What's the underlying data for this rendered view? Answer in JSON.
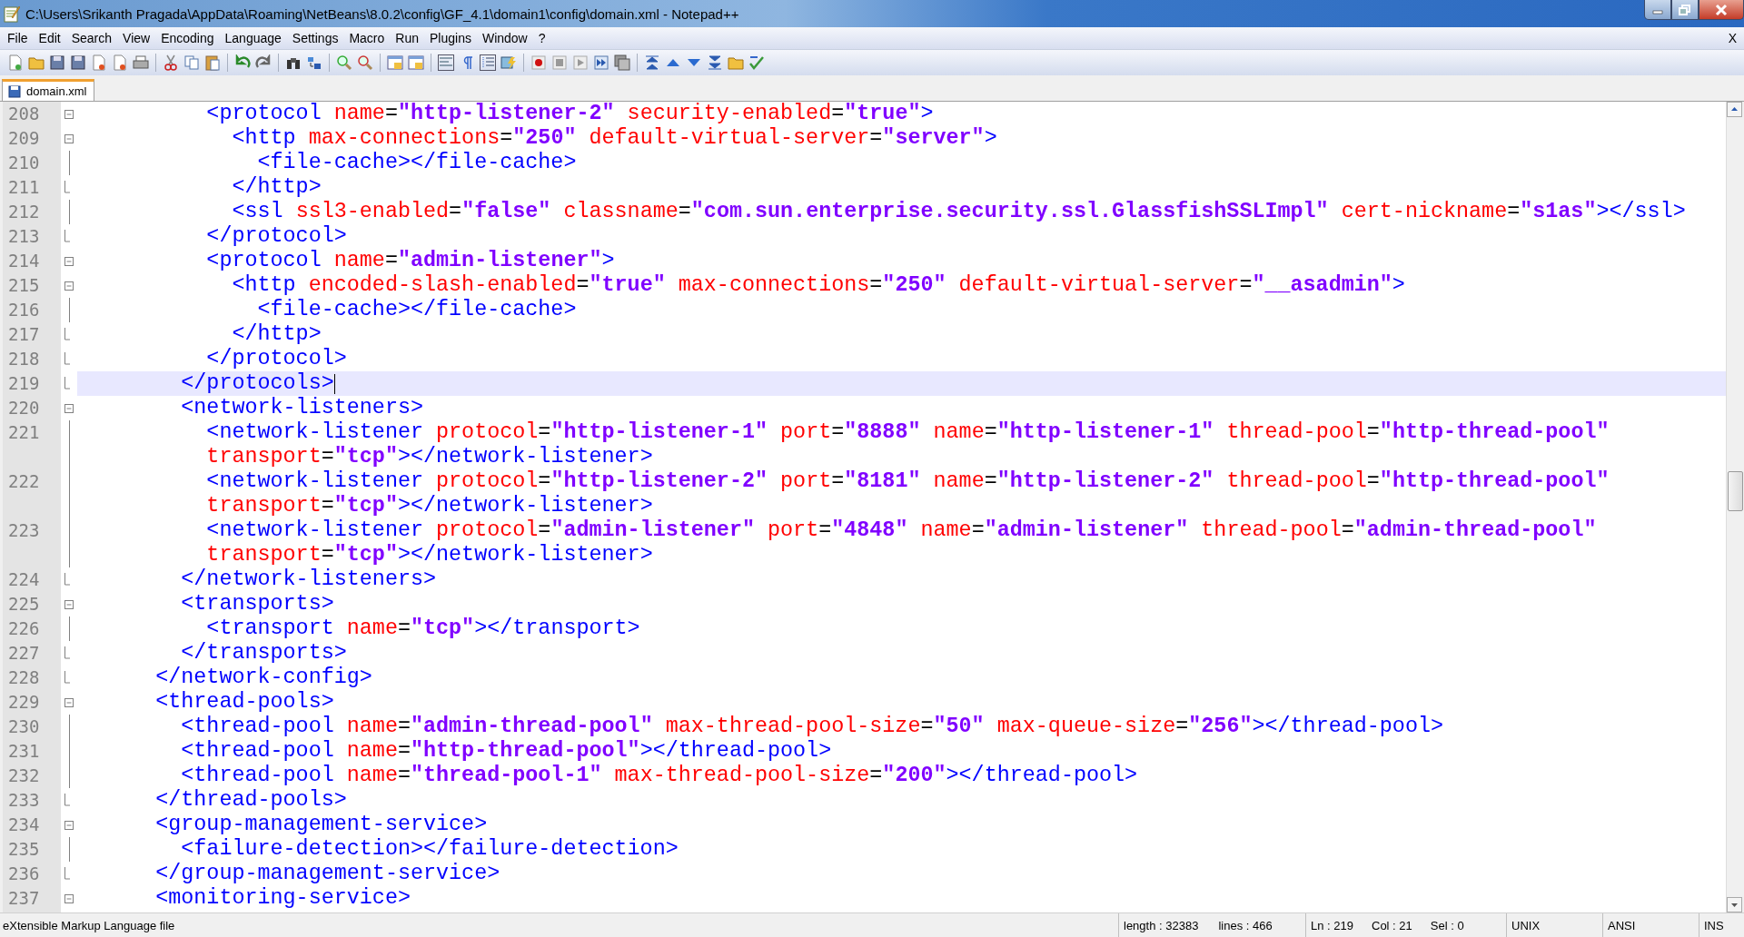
{
  "window": {
    "title": "C:\\Users\\Srikanth Pragada\\AppData\\Roaming\\NetBeans\\8.0.2\\config\\GF_4.1\\domain1\\config\\domain.xml - Notepad++"
  },
  "menu": [
    "File",
    "Edit",
    "Search",
    "View",
    "Encoding",
    "Language",
    "Settings",
    "Macro",
    "Run",
    "Plugins",
    "Window",
    "?"
  ],
  "close_document": "X",
  "tabs": [
    {
      "label": "domain.xml",
      "selected": true
    }
  ],
  "editor": {
    "lines": [
      {
        "number": "208",
        "kind": "open",
        "current": false,
        "segments": [
          {
            "kind": "tag",
            "text": "          <protocol"
          },
          {
            "kind": "attr",
            "text": " name"
          },
          {
            "kind": "op",
            "text": "="
          },
          {
            "kind": "value",
            "text": "\"http-listener-2\""
          },
          {
            "kind": "attr",
            "text": " security-enabled"
          },
          {
            "kind": "op",
            "text": "="
          },
          {
            "kind": "value",
            "text": "\"true\""
          },
          {
            "kind": "tag",
            "text": ">"
          }
        ]
      },
      {
        "number": "209",
        "kind": "open",
        "current": false,
        "segments": [
          {
            "kind": "tag",
            "text": "            <http"
          },
          {
            "kind": "attr",
            "text": " max-connections"
          },
          {
            "kind": "op",
            "text": "="
          },
          {
            "kind": "value",
            "text": "\"250\""
          },
          {
            "kind": "attr",
            "text": " default-virtual-server"
          },
          {
            "kind": "op",
            "text": "="
          },
          {
            "kind": "value",
            "text": "\"server\""
          },
          {
            "kind": "tag",
            "text": ">"
          }
        ]
      },
      {
        "number": "210",
        "kind": "mid",
        "current": false,
        "segments": [
          {
            "kind": "tag",
            "text": "              <file-cache></file-cache>"
          }
        ]
      },
      {
        "number": "211",
        "kind": "end",
        "current": false,
        "segments": [
          {
            "kind": "tag",
            "text": "            </http>"
          }
        ]
      },
      {
        "number": "212",
        "kind": "mid",
        "current": false,
        "segments": [
          {
            "kind": "tag",
            "text": "            <ssl"
          },
          {
            "kind": "attr",
            "text": " ssl3-enabled"
          },
          {
            "kind": "op",
            "text": "="
          },
          {
            "kind": "value",
            "text": "\"false\""
          },
          {
            "kind": "attr",
            "text": " classname"
          },
          {
            "kind": "op",
            "text": "="
          },
          {
            "kind": "value",
            "text": "\"com.sun.enterprise.security.ssl.GlassfishSSLImpl\""
          },
          {
            "kind": "attr",
            "text": " cert-nickname"
          },
          {
            "kind": "op",
            "text": "="
          },
          {
            "kind": "value",
            "text": "\"s1as\""
          },
          {
            "kind": "tag",
            "text": "></ssl>"
          }
        ]
      },
      {
        "number": "213",
        "kind": "end",
        "current": false,
        "segments": [
          {
            "kind": "tag",
            "text": "          </protocol>"
          }
        ]
      },
      {
        "number": "214",
        "kind": "open",
        "current": false,
        "segments": [
          {
            "kind": "tag",
            "text": "          <protocol"
          },
          {
            "kind": "attr",
            "text": " name"
          },
          {
            "kind": "op",
            "text": "="
          },
          {
            "kind": "value",
            "text": "\"admin-listener\""
          },
          {
            "kind": "tag",
            "text": ">"
          }
        ]
      },
      {
        "number": "215",
        "kind": "open",
        "current": false,
        "segments": [
          {
            "kind": "tag",
            "text": "            <http"
          },
          {
            "kind": "attr",
            "text": " encoded-slash-enabled"
          },
          {
            "kind": "op",
            "text": "="
          },
          {
            "kind": "value",
            "text": "\"true\""
          },
          {
            "kind": "attr",
            "text": " max-connections"
          },
          {
            "kind": "op",
            "text": "="
          },
          {
            "kind": "value",
            "text": "\"250\""
          },
          {
            "kind": "attr",
            "text": " default-virtual-server"
          },
          {
            "kind": "op",
            "text": "="
          },
          {
            "kind": "value",
            "text": "\"__asadmin\""
          },
          {
            "kind": "tag",
            "text": ">"
          }
        ]
      },
      {
        "number": "216",
        "kind": "mid",
        "current": false,
        "segments": [
          {
            "kind": "tag",
            "text": "              <file-cache></file-cache>"
          }
        ]
      },
      {
        "number": "217",
        "kind": "end",
        "current": false,
        "segments": [
          {
            "kind": "tag",
            "text": "            </http>"
          }
        ]
      },
      {
        "number": "218",
        "kind": "end",
        "current": false,
        "segments": [
          {
            "kind": "tag",
            "text": "          </protocol>"
          }
        ]
      },
      {
        "number": "219",
        "kind": "end",
        "current": true,
        "segments": [
          {
            "kind": "tag",
            "text": "        </protocols>"
          }
        ]
      },
      {
        "number": "220",
        "kind": "open",
        "current": false,
        "segments": [
          {
            "kind": "tag",
            "text": "        <network-listeners>"
          }
        ]
      },
      {
        "number": "221",
        "kind": "mid",
        "current": false,
        "segments": [
          {
            "kind": "tag",
            "text": "          <network-listener"
          },
          {
            "kind": "attr",
            "text": " protocol"
          },
          {
            "kind": "op",
            "text": "="
          },
          {
            "kind": "value",
            "text": "\"http-listener-1\""
          },
          {
            "kind": "attr",
            "text": " port"
          },
          {
            "kind": "op",
            "text": "="
          },
          {
            "kind": "value",
            "text": "\"8888\""
          },
          {
            "kind": "attr",
            "text": " name"
          },
          {
            "kind": "op",
            "text": "="
          },
          {
            "kind": "value",
            "text": "\"http-listener-1\""
          },
          {
            "kind": "attr",
            "text": " thread-pool"
          },
          {
            "kind": "op",
            "text": "="
          },
          {
            "kind": "value",
            "text": "\"http-thread-pool\""
          }
        ],
        "wrapped": [
          {
            "kind": "attr",
            "text": "          transport"
          },
          {
            "kind": "op",
            "text": "="
          },
          {
            "kind": "value",
            "text": "\"tcp\""
          },
          {
            "kind": "tag",
            "text": "></network-listener>"
          }
        ]
      },
      {
        "number": "222",
        "kind": "mid",
        "current": false,
        "segments": [
          {
            "kind": "tag",
            "text": "          <network-listener"
          },
          {
            "kind": "attr",
            "text": " protocol"
          },
          {
            "kind": "op",
            "text": "="
          },
          {
            "kind": "value",
            "text": "\"http-listener-2\""
          },
          {
            "kind": "attr",
            "text": " port"
          },
          {
            "kind": "op",
            "text": "="
          },
          {
            "kind": "value",
            "text": "\"8181\""
          },
          {
            "kind": "attr",
            "text": " name"
          },
          {
            "kind": "op",
            "text": "="
          },
          {
            "kind": "value",
            "text": "\"http-listener-2\""
          },
          {
            "kind": "attr",
            "text": " thread-pool"
          },
          {
            "kind": "op",
            "text": "="
          },
          {
            "kind": "value",
            "text": "\"http-thread-pool\""
          }
        ],
        "wrapped": [
          {
            "kind": "attr",
            "text": "          transport"
          },
          {
            "kind": "op",
            "text": "="
          },
          {
            "kind": "value",
            "text": "\"tcp\""
          },
          {
            "kind": "tag",
            "text": "></network-listener>"
          }
        ]
      },
      {
        "number": "223",
        "kind": "mid",
        "current": false,
        "segments": [
          {
            "kind": "tag",
            "text": "          <network-listener"
          },
          {
            "kind": "attr",
            "text": " protocol"
          },
          {
            "kind": "op",
            "text": "="
          },
          {
            "kind": "value",
            "text": "\"admin-listener\""
          },
          {
            "kind": "attr",
            "text": " port"
          },
          {
            "kind": "op",
            "text": "="
          },
          {
            "kind": "value",
            "text": "\"4848\""
          },
          {
            "kind": "attr",
            "text": " name"
          },
          {
            "kind": "op",
            "text": "="
          },
          {
            "kind": "value",
            "text": "\"admin-listener\""
          },
          {
            "kind": "attr",
            "text": " thread-pool"
          },
          {
            "kind": "op",
            "text": "="
          },
          {
            "kind": "value",
            "text": "\"admin-thread-pool\""
          }
        ],
        "wrapped": [
          {
            "kind": "attr",
            "text": "          transport"
          },
          {
            "kind": "op",
            "text": "="
          },
          {
            "kind": "value",
            "text": "\"tcp\""
          },
          {
            "kind": "tag",
            "text": "></network-listener>"
          }
        ]
      },
      {
        "number": "224",
        "kind": "end",
        "current": false,
        "segments": [
          {
            "kind": "tag",
            "text": "        </network-listeners>"
          }
        ]
      },
      {
        "number": "225",
        "kind": "open",
        "current": false,
        "segments": [
          {
            "kind": "tag",
            "text": "        <transports>"
          }
        ]
      },
      {
        "number": "226",
        "kind": "mid",
        "current": false,
        "segments": [
          {
            "kind": "tag",
            "text": "          <transport"
          },
          {
            "kind": "attr",
            "text": " name"
          },
          {
            "kind": "op",
            "text": "="
          },
          {
            "kind": "value",
            "text": "\"tcp\""
          },
          {
            "kind": "tag",
            "text": "></transport>"
          }
        ]
      },
      {
        "number": "227",
        "kind": "end",
        "current": false,
        "segments": [
          {
            "kind": "tag",
            "text": "        </transports>"
          }
        ]
      },
      {
        "number": "228",
        "kind": "end",
        "current": false,
        "segments": [
          {
            "kind": "tag",
            "text": "      </network-config>"
          }
        ]
      },
      {
        "number": "229",
        "kind": "open",
        "current": false,
        "segments": [
          {
            "kind": "tag",
            "text": "      <thread-pools>"
          }
        ]
      },
      {
        "number": "230",
        "kind": "mid",
        "current": false,
        "segments": [
          {
            "kind": "tag",
            "text": "        <thread-pool"
          },
          {
            "kind": "attr",
            "text": " name"
          },
          {
            "kind": "op",
            "text": "="
          },
          {
            "kind": "value",
            "text": "\"admin-thread-pool\""
          },
          {
            "kind": "attr",
            "text": " max-thread-pool-size"
          },
          {
            "kind": "op",
            "text": "="
          },
          {
            "kind": "value",
            "text": "\"50\""
          },
          {
            "kind": "attr",
            "text": " max-queue-size"
          },
          {
            "kind": "op",
            "text": "="
          },
          {
            "kind": "value",
            "text": "\"256\""
          },
          {
            "kind": "tag",
            "text": "></thread-pool>"
          }
        ]
      },
      {
        "number": "231",
        "kind": "mid",
        "current": false,
        "segments": [
          {
            "kind": "tag",
            "text": "        <thread-pool"
          },
          {
            "kind": "attr",
            "text": " name"
          },
          {
            "kind": "op",
            "text": "="
          },
          {
            "kind": "value",
            "text": "\"http-thread-pool\""
          },
          {
            "kind": "tag",
            "text": "></thread-pool>"
          }
        ]
      },
      {
        "number": "232",
        "kind": "mid",
        "current": false,
        "segments": [
          {
            "kind": "tag",
            "text": "        <thread-pool"
          },
          {
            "kind": "attr",
            "text": " name"
          },
          {
            "kind": "op",
            "text": "="
          },
          {
            "kind": "value",
            "text": "\"thread-pool-1\""
          },
          {
            "kind": "attr",
            "text": " max-thread-pool-size"
          },
          {
            "kind": "op",
            "text": "="
          },
          {
            "kind": "value",
            "text": "\"200\""
          },
          {
            "kind": "tag",
            "text": "></thread-pool>"
          }
        ]
      },
      {
        "number": "233",
        "kind": "end",
        "current": false,
        "segments": [
          {
            "kind": "tag",
            "text": "      </thread-pools>"
          }
        ]
      },
      {
        "number": "234",
        "kind": "open",
        "current": false,
        "segments": [
          {
            "kind": "tag",
            "text": "      <group-management-service>"
          }
        ]
      },
      {
        "number": "235",
        "kind": "mid",
        "current": false,
        "segments": [
          {
            "kind": "tag",
            "text": "        <failure-detection></failure-detection>"
          }
        ]
      },
      {
        "number": "236",
        "kind": "end",
        "current": false,
        "segments": [
          {
            "kind": "tag",
            "text": "      </group-management-service>"
          }
        ]
      },
      {
        "number": "237",
        "kind": "open",
        "current": false,
        "segments": [
          {
            "kind": "tag",
            "text": "      <monitoring-service>"
          }
        ]
      }
    ]
  },
  "status_bar": {
    "file_type": "eXtensible Markup Language file",
    "sections": [
      [
        "length : 32383",
        "lines : 466"
      ],
      [
        "Ln : 219",
        "Col : 21",
        "Sel : 0"
      ],
      [
        "UNIX"
      ],
      [
        "ANSI"
      ],
      [
        "INS"
      ]
    ]
  }
}
